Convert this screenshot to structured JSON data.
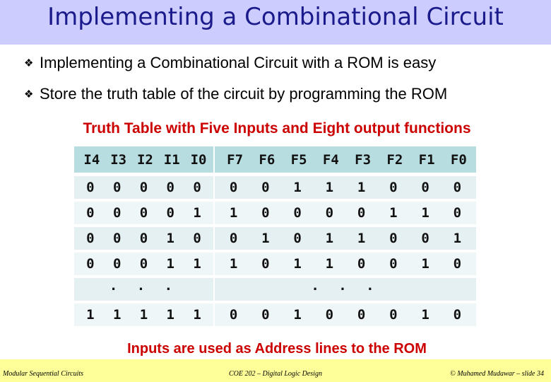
{
  "slide": {
    "title": "Implementing a Combinational Circuit",
    "bullets": [
      {
        "icon": "diamond-bullet-icon",
        "glyph": "❖",
        "text": "Implementing a Combinational Circuit with a ROM is easy"
      },
      {
        "icon": "diamond-bullet-icon",
        "glyph": "❖",
        "text": "Store the truth table of the circuit by programming the ROM"
      }
    ],
    "table_caption": "Truth Table with Five Inputs and Eight output functions",
    "bottom_caption": "Inputs are used as Address lines to the ROM",
    "colors": {
      "title_bar": "#ccccff",
      "title_text": "#1a1a8c",
      "caption_red": "#cc0000",
      "table_header": "#b8dde1",
      "table_row_dark": "#e5f0f2",
      "table_row_light": "#eff6f7",
      "footer_bar": "#ffff99"
    }
  },
  "truth_table": {
    "input_headers": [
      "I4",
      "I3",
      "I2",
      "I1",
      "I0"
    ],
    "output_headers": [
      "F7",
      "F6",
      "F5",
      "F4",
      "F3",
      "F2",
      "F1",
      "F0"
    ],
    "rows": [
      {
        "inputs": [
          "0",
          "0",
          "0",
          "0",
          "0"
        ],
        "outputs": [
          "0",
          "0",
          "1",
          "1",
          "1",
          "0",
          "0",
          "0"
        ]
      },
      {
        "inputs": [
          "0",
          "0",
          "0",
          "0",
          "1"
        ],
        "outputs": [
          "1",
          "0",
          "0",
          "0",
          "0",
          "1",
          "1",
          "0"
        ]
      },
      {
        "inputs": [
          "0",
          "0",
          "0",
          "1",
          "0"
        ],
        "outputs": [
          "0",
          "1",
          "0",
          "1",
          "1",
          "0",
          "0",
          "1"
        ]
      },
      {
        "inputs": [
          "0",
          "0",
          "0",
          "1",
          "1"
        ],
        "outputs": [
          "1",
          "0",
          "1",
          "1",
          "0",
          "0",
          "1",
          "0"
        ]
      },
      {
        "ellipsis": ". . .",
        "ellipsis_out": ". . ."
      },
      {
        "inputs": [
          "1",
          "1",
          "1",
          "1",
          "1"
        ],
        "outputs": [
          "0",
          "0",
          "1",
          "0",
          "0",
          "0",
          "1",
          "0"
        ]
      }
    ]
  },
  "footer": {
    "left": "Modular Sequential Circuits",
    "center": "COE 202 – Digital Logic Design",
    "right": "© Muhamed Mudawar – slide 34"
  }
}
